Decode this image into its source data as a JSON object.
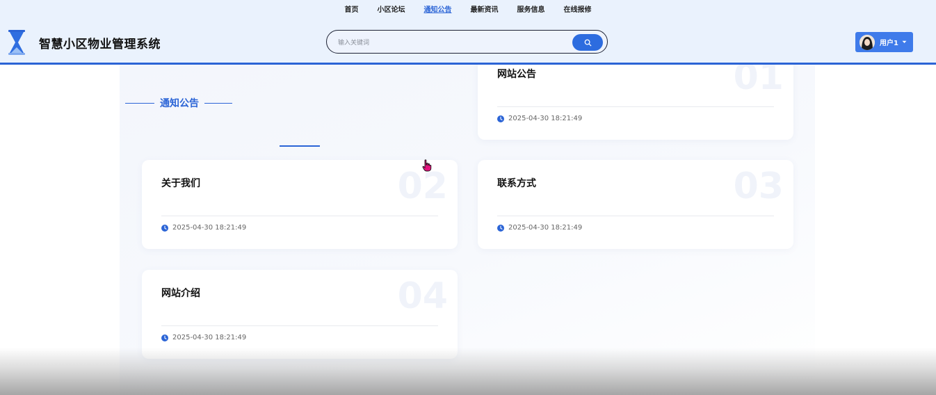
{
  "header": {
    "nav": [
      {
        "label": "首页",
        "active": false
      },
      {
        "label": "小区论坛",
        "active": false
      },
      {
        "label": "通知公告",
        "active": true
      },
      {
        "label": "最新资讯",
        "active": false
      },
      {
        "label": "服务信息",
        "active": false
      },
      {
        "label": "在线报修",
        "active": false
      }
    ],
    "brand": "智慧小区物业管理系统",
    "search": {
      "placeholder": "输入关键词",
      "icon": "search-icon"
    },
    "user": {
      "label": "用户1",
      "icon": "chevron-down-icon"
    }
  },
  "section": {
    "title": "通知公告"
  },
  "cards": [
    {
      "num": "01",
      "title": "网站公告",
      "date": "2025-04-30 18:21:49"
    },
    {
      "num": "02",
      "title": "关于我们",
      "date": "2025-04-30 18:21:49"
    },
    {
      "num": "03",
      "title": "联系方式",
      "date": "2025-04-30 18:21:49"
    },
    {
      "num": "04",
      "title": "网站介绍",
      "date": "2025-04-30 18:21:49"
    }
  ],
  "colors": {
    "accent": "#2b64d6",
    "header_bg": "#eaf2fd",
    "user_btn": "#3f7bea"
  }
}
